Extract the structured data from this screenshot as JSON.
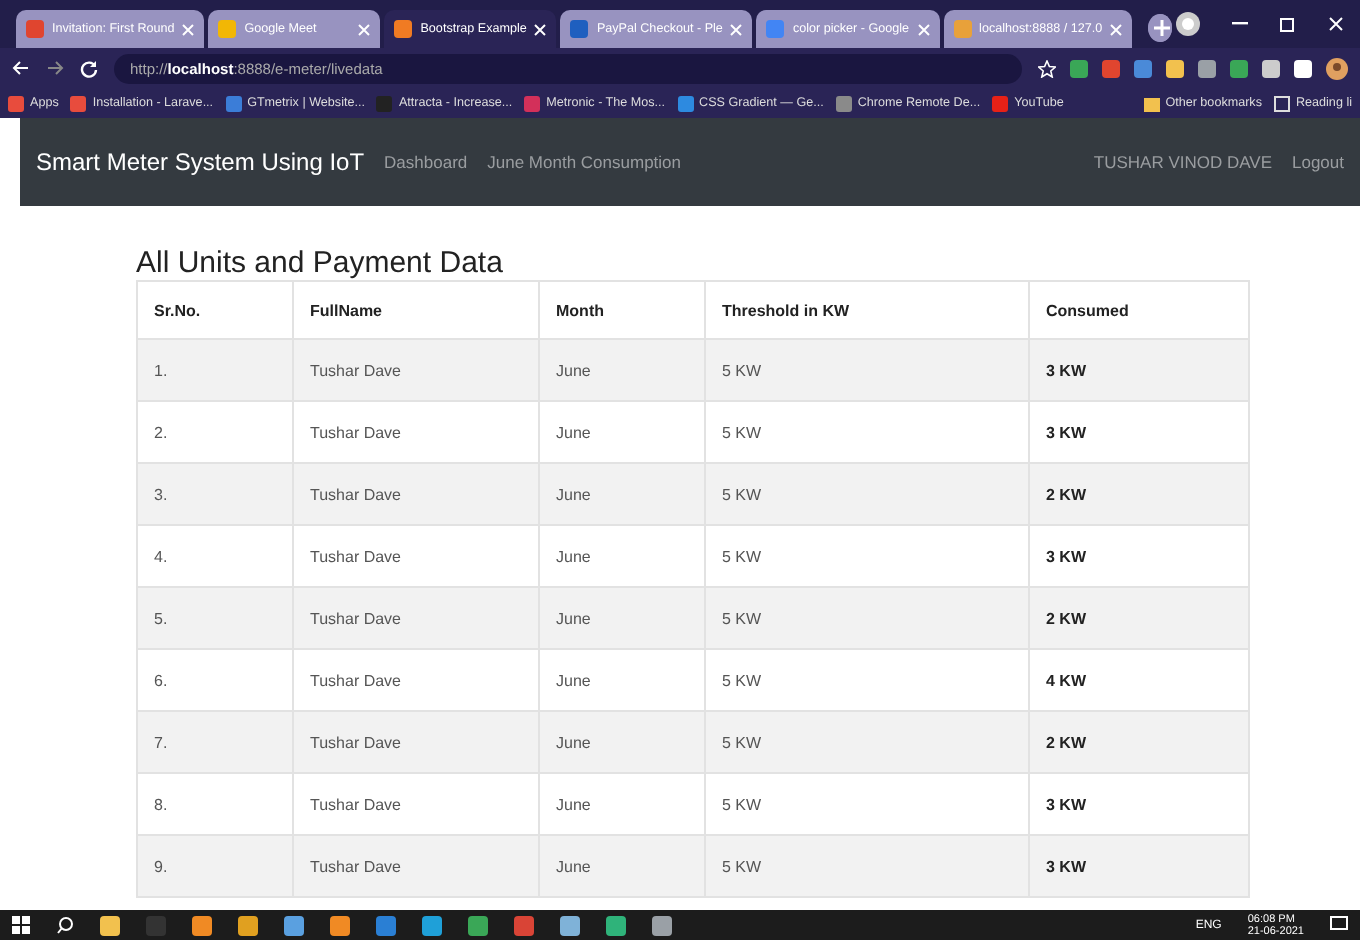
{
  "browser": {
    "tabs": [
      {
        "title": "Invitation: First Round",
        "selected": false,
        "color": "#e0452f"
      },
      {
        "title": "Google Meet",
        "selected": false,
        "color": "#f2b705"
      },
      {
        "title": "Bootstrap Example",
        "selected": true,
        "color": "#f07b23"
      },
      {
        "title": "PayPal Checkout - Ple",
        "selected": false,
        "color": "#1f5fbf"
      },
      {
        "title": "color picker - Google",
        "selected": false,
        "color": "#4285f4"
      },
      {
        "title": "localhost:8888 / 127.0",
        "selected": false,
        "color": "#e8a13a"
      }
    ],
    "address": {
      "prefix": "http://",
      "host": "localhost",
      "rest": ":8888/e-meter/livedata"
    },
    "bookmarks": [
      {
        "label": "Apps",
        "color": "#e84c3d"
      },
      {
        "label": "Installation - Larave...",
        "color": "#e84c3d"
      },
      {
        "label": "GTmetrix | Website...",
        "color": "#3b7dd8"
      },
      {
        "label": "Attracta - Increase...",
        "color": "#222222"
      },
      {
        "label": "Metronic - The Mos...",
        "color": "#d3305a"
      },
      {
        "label": "CSS Gradient — Ge...",
        "color": "#2d8ae0"
      },
      {
        "label": "Chrome Remote De...",
        "color": "#8a8a8a"
      },
      {
        "label": "YouTube",
        "color": "#e62117"
      }
    ],
    "other_bookmarks": "Other bookmarks",
    "reading_list": "Reading li"
  },
  "navbar": {
    "brand": "Smart Meter System Using IoT",
    "links": [
      "Dashboard",
      "June Month Consumption"
    ],
    "user": "TUSHAR VINOD DAVE",
    "logout": "Logout"
  },
  "page": {
    "title": "All Units and Payment Data"
  },
  "table": {
    "columns": [
      "Sr.No.",
      "FullName",
      "Month",
      "Threshold in KW",
      "Consumed"
    ],
    "rows": [
      [
        "1.",
        "Tushar Dave",
        "June",
        "5 KW",
        "3 KW"
      ],
      [
        "2.",
        "Tushar Dave",
        "June",
        "5 KW",
        "3 KW"
      ],
      [
        "3.",
        "Tushar Dave",
        "June",
        "5 KW",
        "2 KW"
      ],
      [
        "4.",
        "Tushar Dave",
        "June",
        "5 KW",
        "3 KW"
      ],
      [
        "5.",
        "Tushar Dave",
        "June",
        "5 KW",
        "2 KW"
      ],
      [
        "6.",
        "Tushar Dave",
        "June",
        "5 KW",
        "4 KW"
      ],
      [
        "7.",
        "Tushar Dave",
        "June",
        "5 KW",
        "2 KW"
      ],
      [
        "8.",
        "Tushar Dave",
        "June",
        "5 KW",
        "3 KW"
      ],
      [
        "9.",
        "Tushar Dave",
        "June",
        "5 KW",
        "3 KW"
      ]
    ]
  },
  "taskbar": {
    "apps": [
      {
        "color": "#f2c14e"
      },
      {
        "color": "#333333"
      },
      {
        "color": "#f08a24"
      },
      {
        "color": "#e0a020"
      },
      {
        "color": "#5aa0e0"
      },
      {
        "color": "#f08a24"
      },
      {
        "color": "#2a7fd4"
      },
      {
        "color": "#1fa0d8"
      },
      {
        "color": "#3aa757"
      },
      {
        "color": "#d94436"
      },
      {
        "color": "#7fb2d8"
      },
      {
        "color": "#2fb37a"
      },
      {
        "color": "#9aa0a6"
      }
    ],
    "language": "ENG",
    "time": "06:08 PM",
    "date": "21-06-2021"
  }
}
